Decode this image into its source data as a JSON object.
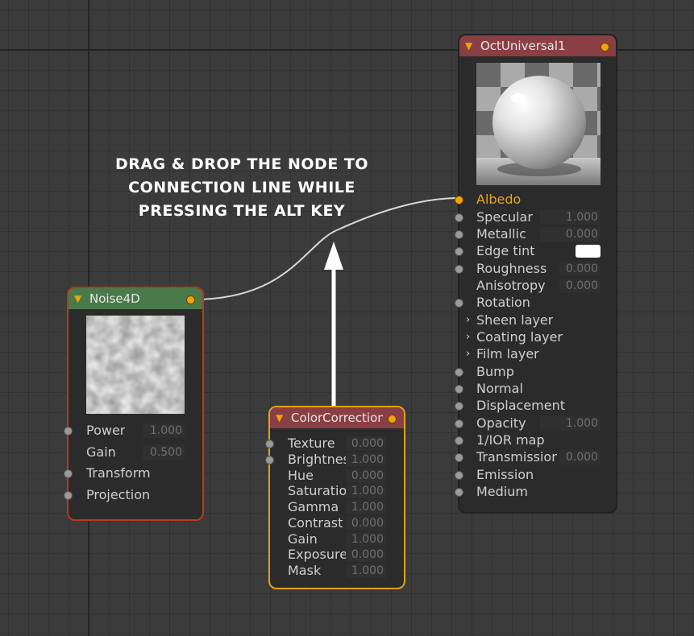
{
  "instruction": {
    "lines": [
      "DRAG & DROP THE NODE TO",
      "CONNECTION LINE WHILE",
      "PRESSING THE ALT KEY"
    ]
  },
  "noise_node": {
    "title": "Noise4D",
    "header_color": "#4a7a4a",
    "border_color": "#b8391c",
    "rows": [
      {
        "label": "Power",
        "value": "1.000"
      },
      {
        "label": "Gain",
        "value": "0.500"
      },
      {
        "label": "Transform"
      },
      {
        "label": "Projection"
      }
    ]
  },
  "color_node": {
    "title": "ColorCorrection",
    "header_color": "#8a3f44",
    "border_color": "#e0a21a",
    "rows": [
      {
        "label": "Texture",
        "value": "0.000"
      },
      {
        "label": "Brightness",
        "value": "1.000"
      },
      {
        "label": "Hue",
        "value": "0.000"
      },
      {
        "label": "Saturation",
        "value": "1.000"
      },
      {
        "label": "Gamma",
        "value": "1.000"
      },
      {
        "label": "Contrast",
        "value": "0.000"
      },
      {
        "label": "Gain",
        "value": "1.000"
      },
      {
        "label": "Exposure",
        "value": "0.000"
      },
      {
        "label": "Mask",
        "value": "1.000"
      }
    ]
  },
  "oct_node": {
    "title": "OctUniversal1",
    "header_color": "#8a3f44",
    "rows": [
      {
        "label": "Albedo"
      },
      {
        "label": "Specular",
        "value": "1.000"
      },
      {
        "label": "Metallic",
        "value": "0.000"
      },
      {
        "label": "Edge tint"
      },
      {
        "label": "Roughness",
        "value": "0.000"
      },
      {
        "label": "Anisotropy",
        "value": "0.000"
      },
      {
        "label": "Rotation"
      },
      {
        "label": "Sheen layer"
      },
      {
        "label": "Coating layer"
      },
      {
        "label": "Film layer"
      },
      {
        "label": "Bump"
      },
      {
        "label": "Normal"
      },
      {
        "label": "Displacement"
      },
      {
        "label": "Opacity",
        "value": "1.000"
      },
      {
        "label": "1/IOR map"
      },
      {
        "label": "Transmission",
        "value": "0.000"
      },
      {
        "label": "Emission"
      },
      {
        "label": "Medium"
      }
    ]
  },
  "colors": {
    "accent": "#f0a30a",
    "albedo_text": "#e8a21b"
  }
}
